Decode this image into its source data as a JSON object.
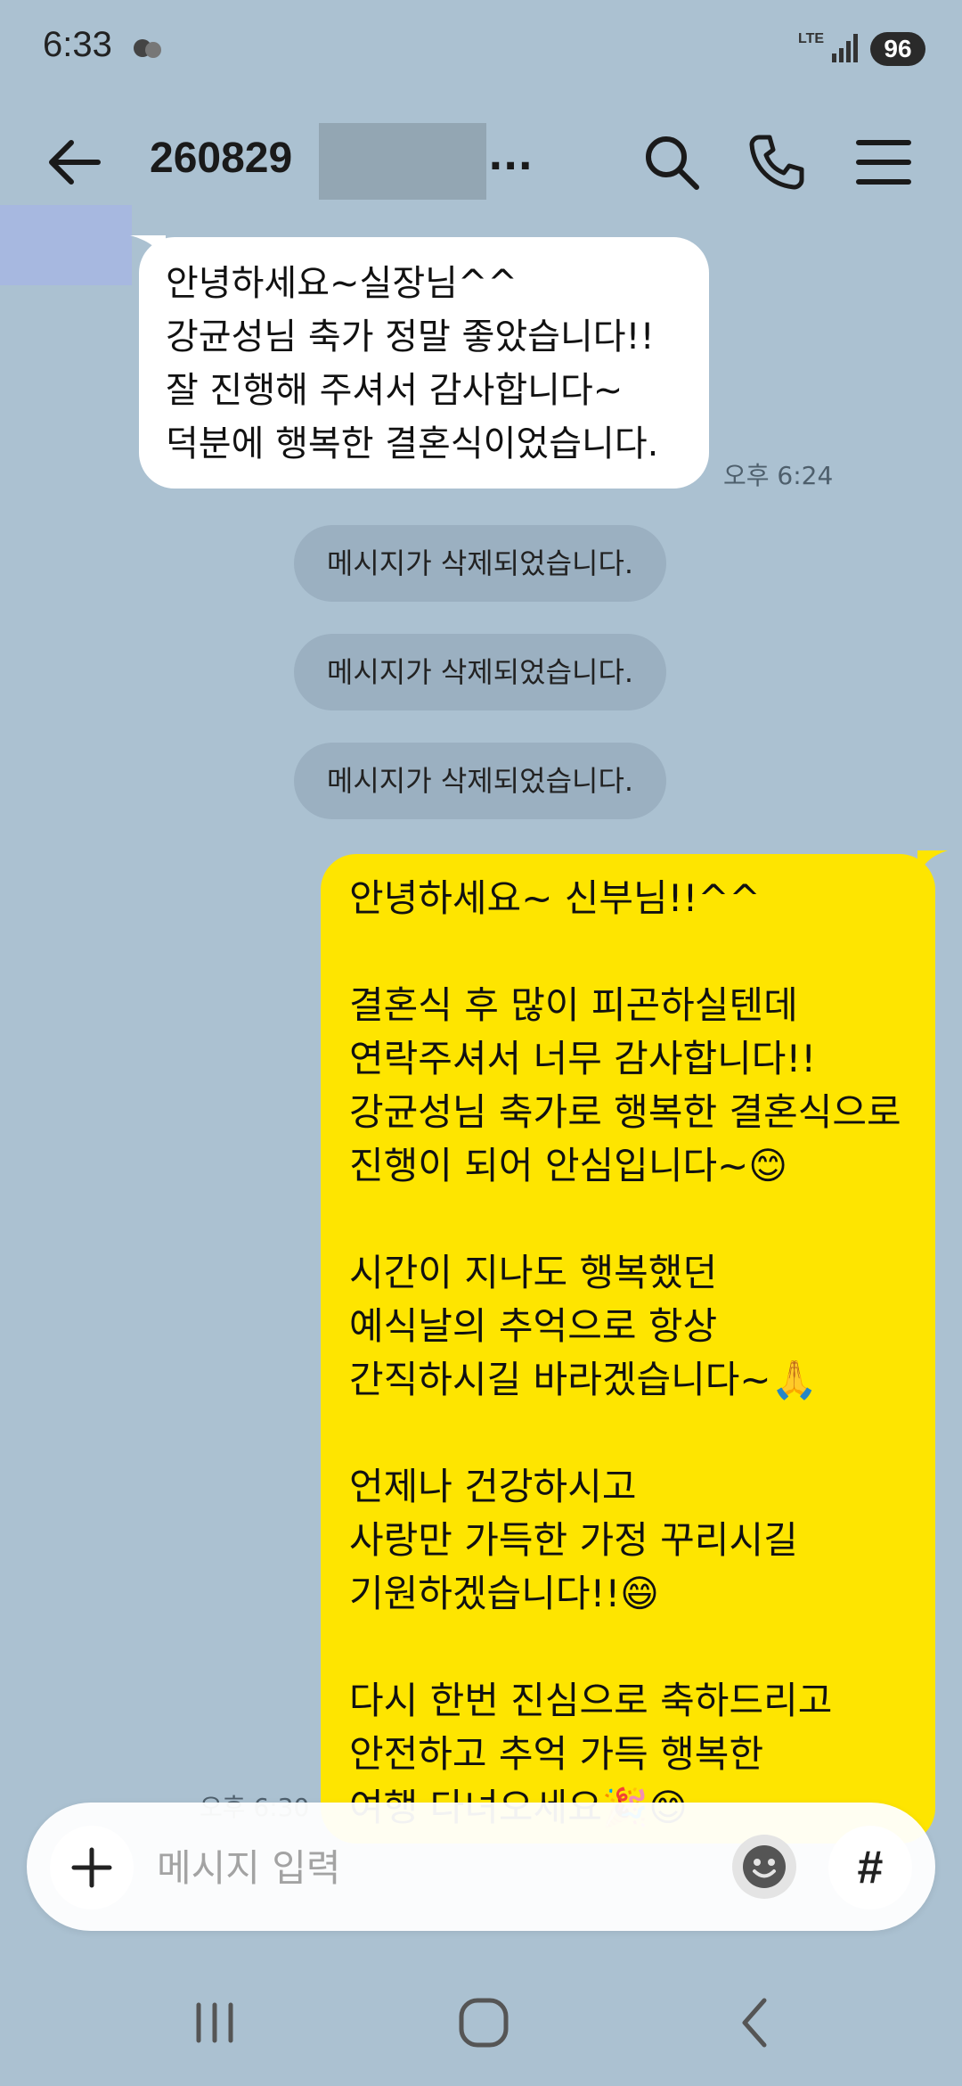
{
  "status_bar": {
    "time": "6:33",
    "network": "LTE",
    "battery": "96"
  },
  "header": {
    "title": "260829",
    "ellipsis": "...",
    "icons": [
      "back-arrow-icon",
      "search-icon",
      "phone-icon",
      "menu-icon"
    ]
  },
  "messages": {
    "incoming": {
      "text": "안녕하세요~실장님^^\n강균성님 축가 정말 좋았습니다!!\n잘 진행해 주셔서 감사합니다~\n덕분에 행복한 결혼식이었습니다.",
      "time": "오후 6:24"
    },
    "deleted": [
      "메시지가 삭제되었습니다.",
      "메시지가 삭제되었습니다.",
      "메시지가 삭제되었습니다."
    ],
    "outgoing": {
      "text": "안녕하세요~ 신부님!!^^\n\n결혼식 후 많이 피곤하실텐데\n연락주셔서 너무 감사합니다!!\n강균성님 축가로 행복한 결혼식으로\n진행이 되어 안심입니다~😊\n\n시간이 지나도 행복했던\n예식날의 추억으로 항상\n간직하시길 바라겠습니다~🙏\n\n언제나 건강하시고\n사랑만 가득한 가정 꾸리시길\n기원하겠습니다!!😄\n\n다시 한번 진심으로 축하드리고\n안전하고 추억 가득 행복한\n여행 다녀오세요🎉😊",
      "time": "오후 6:30"
    }
  },
  "input": {
    "placeholder": "메시지 입력",
    "hash_label": "#"
  },
  "colors": {
    "background": "#abc1d1",
    "outgoing_bubble": "#fee500",
    "incoming_bubble": "#ffffff"
  }
}
